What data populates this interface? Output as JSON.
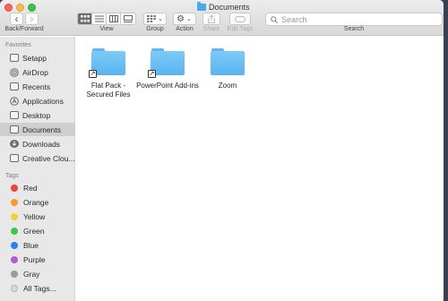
{
  "window": {
    "title": "Documents"
  },
  "toolbar": {
    "nav_label": "Back/Forward",
    "back_glyph": "‹",
    "forward_glyph": "›",
    "view_label": "View",
    "group_label": "Group",
    "action_label": "Action",
    "share_label": "Share",
    "edit_tags_label": "Edit Tags",
    "search_label": "Search",
    "search_placeholder": "Search",
    "group_caret": "⌄",
    "action_glyph": "⚙",
    "action_caret": "⌄"
  },
  "sidebar": {
    "favorites_header": "Favorites",
    "favorites": [
      {
        "label": "Setapp",
        "icon": "setapp-icon"
      },
      {
        "label": "AirDrop",
        "icon": "airdrop-icon"
      },
      {
        "label": "Recents",
        "icon": "recents-icon"
      },
      {
        "label": "Applications",
        "icon": "applications-icon"
      },
      {
        "label": "Desktop",
        "icon": "desktop-icon"
      },
      {
        "label": "Documents",
        "icon": "documents-icon",
        "selected": true
      },
      {
        "label": "Downloads",
        "icon": "downloads-icon"
      },
      {
        "label": "Creative Clou...",
        "icon": "creative-cloud-icon"
      }
    ],
    "tags_header": "Tags",
    "tags": [
      {
        "label": "Red",
        "color": "#f0443a"
      },
      {
        "label": "Orange",
        "color": "#f79a2b"
      },
      {
        "label": "Yellow",
        "color": "#f5d02f"
      },
      {
        "label": "Green",
        "color": "#3ec64c"
      },
      {
        "label": "Blue",
        "color": "#2a82f0"
      },
      {
        "label": "Purple",
        "color": "#b45bd3"
      },
      {
        "label": "Gray",
        "color": "#9a9a9a"
      },
      {
        "label": "All Tags...",
        "color": "#d8d8d8"
      }
    ]
  },
  "files": [
    {
      "name": "Flat Pack - Secured Files",
      "alias": true
    },
    {
      "name": "PowerPoint Add-ins",
      "alias": true
    },
    {
      "name": "Zoom",
      "alias": false
    }
  ],
  "colors": {
    "accent": "#5ab4ee",
    "selected_row": "#cfcfcf"
  }
}
